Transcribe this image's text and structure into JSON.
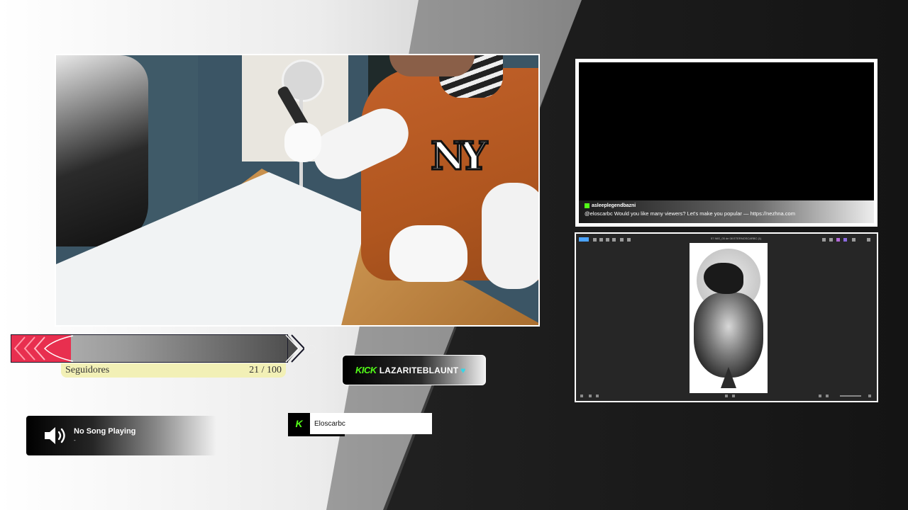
{
  "chat": {
    "username": "asleeplegendbazni",
    "message": "@eloscarbc Would you like many viewers? Let's make you popular — https://nezhna.com"
  },
  "editor": {
    "file_name": "57 IMG_05 de 08 ETERNOSCARBC (1)"
  },
  "goal": {
    "label": "Seguidores",
    "current": 21,
    "target": 100,
    "count_text": "21 / 100",
    "fill_color": "#e82f4f"
  },
  "kick_badge": {
    "logo_text": "KICK",
    "channel": "LAZARITEBLAUNT",
    "heart": "♥",
    "accent": "#53fc18"
  },
  "music": {
    "title": "No Song Playing",
    "artist": "-"
  },
  "latest_follower": {
    "logo_text": "K",
    "name": "Eloscarbc"
  }
}
